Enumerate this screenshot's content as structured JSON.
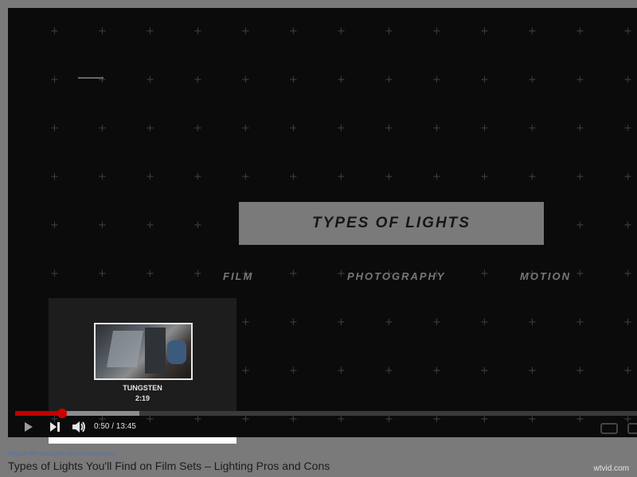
{
  "video": {
    "title_card": "TYPES OF LIGHTS",
    "categories": [
      "FILM",
      "PHOTOGRAPHY",
      "MOTION"
    ]
  },
  "preview": {
    "label": "TUNGSTEN",
    "time": "2:19"
  },
  "progress": {
    "played_fraction": 0.075,
    "hover_fraction": 0.2,
    "buffered_fraction": 0.175
  },
  "controls": {
    "time_display": "0:50 / 13:45",
    "play_icon": "play-icon",
    "next_icon": "next-icon",
    "volume_icon": "volume-icon"
  },
  "page": {
    "hashtags": "#lights #filmsetlights #cinematography",
    "video_title": "Types of Lights You'll Find on Film Sets – Lighting Pros and Cons",
    "watermark": "wtvid.com"
  }
}
